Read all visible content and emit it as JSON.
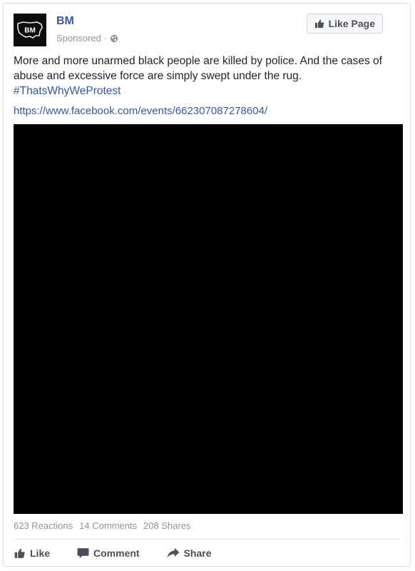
{
  "post": {
    "page_name": "BM",
    "avatar_text": "BM",
    "sponsored_label": "Sponsored",
    "separator": "·",
    "like_page_label": "Like Page",
    "text": "More and more unarmed black people are killed by police. And the cases of abuse and excessive force are simply swept under the rug.",
    "hashtag": "#ThatsWhyWeProtest",
    "link": "https://www.facebook.com/events/662307087278604/"
  },
  "stats": {
    "reactions": "623 Reactions",
    "comments": "14 Comments",
    "shares": "208 Shares"
  },
  "actions": {
    "like": "Like",
    "comment": "Comment",
    "share": "Share"
  },
  "colors": {
    "link_blue": "#365899",
    "meta_gray": "#90949c",
    "button_text": "#4b4f56",
    "media_background": "#000000"
  },
  "icons": {
    "avatar_logo": "us-map-logo",
    "audience": "globe-icon",
    "like_page": "thumbs-up-icon",
    "like": "thumbs-up-icon",
    "comment": "comment-bubble-icon",
    "share": "share-arrow-icon"
  }
}
